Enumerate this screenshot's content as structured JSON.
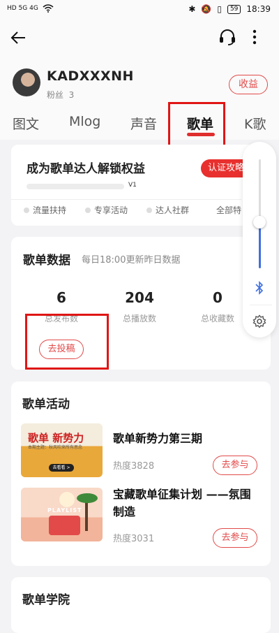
{
  "status_bar": {
    "left_text": "HD 5G 4G",
    "battery": "59",
    "time": "18:39"
  },
  "header": {
    "back_icon": "arrow-left-icon",
    "headset_icon": "headset-icon",
    "more_icon": "more-vertical-icon"
  },
  "profile": {
    "username": "KADXXXNH",
    "fans_label": "粉丝",
    "fans_count": "3",
    "earnings_button": "收益"
  },
  "tabs": [
    {
      "label": "图文",
      "active": false
    },
    {
      "label": "Mlog",
      "active": false
    },
    {
      "label": "声音",
      "active": false
    },
    {
      "label": "歌单",
      "active": true
    },
    {
      "label": "K歌",
      "active": false
    }
  ],
  "promo_card": {
    "title": "成为歌单达人解锁权益",
    "button": "认证攻略",
    "level": "V1",
    "features": [
      "流量扶持",
      "专享活动",
      "达人社群",
      "全部特"
    ]
  },
  "data_card": {
    "title": "歌单数据",
    "subtitle": "每日18:00更新昨日数据",
    "stats": [
      {
        "value": "6",
        "label": "总发布数"
      },
      {
        "value": "204",
        "label": "总播放数"
      },
      {
        "value": "0",
        "label": "总收藏数"
      }
    ],
    "submit_button": "去投稿"
  },
  "activities": {
    "title": "歌单活动",
    "items": [
      {
        "title": "歌单新势力第三期",
        "heat": "热度3828",
        "button": "去参与",
        "thumb_title": "歌单 新势力",
        "thumb_sub": "本期主题：秋风吹来所有思念",
        "thumb_btn": "去看看 >"
      },
      {
        "title": "宝藏歌单征集计划 ——氛围制造",
        "heat": "热度3031",
        "button": "去参与",
        "thumb_title": "PLAYLIST"
      }
    ]
  },
  "academy": {
    "title": "歌单学院"
  },
  "volume_panel": {
    "level_percent": 45,
    "bluetooth_icon": "bluetooth-icon",
    "settings_icon": "gear-icon"
  },
  "colors": {
    "accent": "#e8302e",
    "highlight_box": "#e01515",
    "volume_blue": "#3f6fe0"
  }
}
